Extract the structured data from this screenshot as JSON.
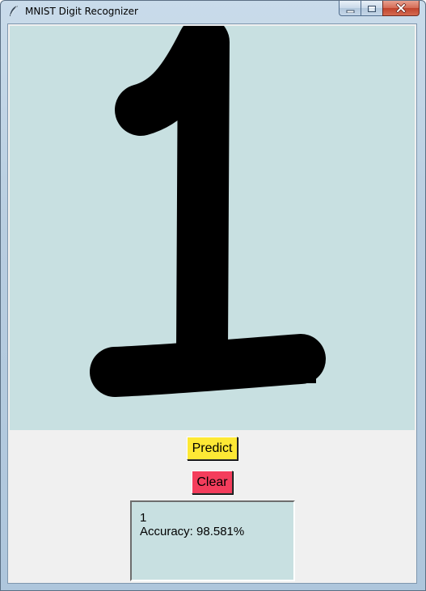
{
  "window": {
    "title": "MNIST Digit Recognizer",
    "controls": {
      "minimize_icon": "minimize-icon",
      "maximize_icon": "maximize-icon",
      "close_icon": "close-icon"
    }
  },
  "canvas": {
    "background": "#c8e0e1",
    "stroke_color": "#000000",
    "drawn_digit": "1"
  },
  "buttons": {
    "predict": {
      "label": "Predict",
      "color": "#fde835"
    },
    "clear": {
      "label": "Clear",
      "color": "#f43d5c"
    }
  },
  "result": {
    "prediction": "1",
    "accuracy": "Accuracy: 98.581%"
  }
}
